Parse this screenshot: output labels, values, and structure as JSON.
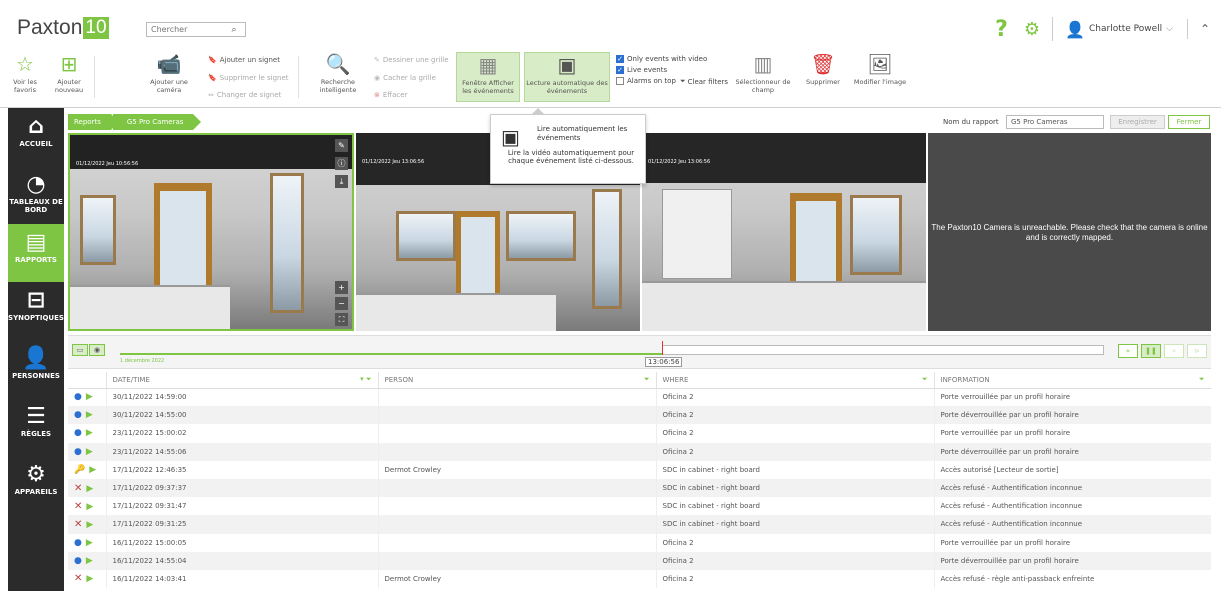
{
  "app": {
    "logo_text": "Paxton",
    "logo_num": "10"
  },
  "search": {
    "placeholder": "Chercher",
    "value": "Chercher"
  },
  "user": {
    "name": "Charlotte Powell",
    "help": "?"
  },
  "toolbar": {
    "favorites": "Voir les favoris",
    "add_new": "Ajouter nouveau",
    "add_camera": "Ajouter une caméra",
    "add_bookmark": "Ajouter un signet",
    "delete_bookmark": "Supprimer le signet",
    "change_bookmark": "Changer de signet",
    "smart_search": "Recherche intelligente",
    "draw_grid": "Dessiner une grille",
    "hide_grid": "Cacher la grille",
    "clear": "Effacer",
    "events_window": "Fenêtre Afficher les événements",
    "autoplay": "Lecture automatique des événements",
    "only_events_video": "Only events with video",
    "live_events": "Live events",
    "alarms_on_top": "Alarms on top",
    "clear_filters": "Clear filters",
    "field_selector": "Sélectionneur de champ",
    "delete": "Supprimer",
    "edit_image": "Modifier l'image"
  },
  "sidebar": {
    "items": [
      {
        "label": "ACCUEIL",
        "icon": "home-icon"
      },
      {
        "label": "TABLEAUX DE BORD",
        "icon": "dashboard-icon"
      },
      {
        "label": "RAPPORTS",
        "icon": "reports-icon"
      },
      {
        "label": "SYNOPTIQUES",
        "icon": "floorplan-icon"
      },
      {
        "label": "PERSONNES",
        "icon": "person-icon"
      },
      {
        "label": "RÈGLES",
        "icon": "rules-icon"
      },
      {
        "label": "APPAREILS",
        "icon": "devices-icon"
      }
    ]
  },
  "breadcrumb": {
    "root": "Reports",
    "current": "G5 Pro Cameras"
  },
  "report": {
    "name_label": "Nom du rapport",
    "name_value": "G5 Pro Cameras",
    "save": "Enregistrer",
    "close": "Fermer"
  },
  "tooltip": {
    "title": "Lire automatiquement les événements",
    "body": "Lire la vidéo automatiquement pour chaque événement listé ci-dessous."
  },
  "cameras": {
    "ts1": "01/12/2022 Jeu 10:56:56",
    "ts2": "01/12/2022 Jeu 13:06:56",
    "ts3": "01/12/2022 Jeu 13:06:56",
    "unreachable": "The Paxton10 Camera is unreachable. Please check that the camera is online and is correctly mapped."
  },
  "timeline": {
    "time": "13:06:56",
    "date": "1 décembre 2022"
  },
  "table": {
    "headers": [
      "DATE/TIME",
      "PERSON",
      "WHERE",
      "INFORMATION"
    ],
    "rows": [
      {
        "icon": "info",
        "date": "30/11/2022 14:59:00",
        "person": "",
        "where": "Oficina 2",
        "info": "Porte verrouillée par un profil horaire"
      },
      {
        "icon": "info",
        "date": "30/11/2022 14:55:00",
        "person": "",
        "where": "Oficina 2",
        "info": "Porte déverrouillée par un profil horaire"
      },
      {
        "icon": "info",
        "date": "23/11/2022 15:00:02",
        "person": "",
        "where": "Oficina 2",
        "info": "Porte verrouillée par un profil horaire"
      },
      {
        "icon": "info",
        "date": "23/11/2022 14:55:06",
        "person": "",
        "where": "Oficina 2",
        "info": "Porte déverrouillée par un profil horaire"
      },
      {
        "icon": "key",
        "date": "17/11/2022 12:46:35",
        "person": "Dermot Crowley",
        "where": "SDC in cabinet - right board",
        "info": "Accès autorisé [Lecteur de sortie]"
      },
      {
        "icon": "x",
        "date": "17/11/2022 09:37:37",
        "person": "",
        "where": "SDC in cabinet - right board",
        "info": "Accès refusé - Authentification inconnue"
      },
      {
        "icon": "x",
        "date": "17/11/2022 09:31:47",
        "person": "",
        "where": "SDC in cabinet - right board",
        "info": "Accès refusé - Authentification inconnue"
      },
      {
        "icon": "x",
        "date": "17/11/2022 09:31:25",
        "person": "",
        "where": "SDC in cabinet - right board",
        "info": "Accès refusé - Authentification inconnue"
      },
      {
        "icon": "info",
        "date": "16/11/2022 15:00:05",
        "person": "",
        "where": "Oficina 2",
        "info": "Porte verrouillée par un profil horaire"
      },
      {
        "icon": "info",
        "date": "16/11/2022 14:55:04",
        "person": "",
        "where": "Oficina 2",
        "info": "Porte déverrouillée par un profil horaire"
      },
      {
        "icon": "x",
        "date": "16/11/2022 14:03:41",
        "person": "Dermot Crowley",
        "where": "Oficina 2",
        "info": "Accès refusé - règle anti-passback enfreinte"
      }
    ]
  },
  "colors": {
    "accent": "#7ec544",
    "sidebar": "#2b2b2b",
    "info": "#2b6fd1"
  }
}
